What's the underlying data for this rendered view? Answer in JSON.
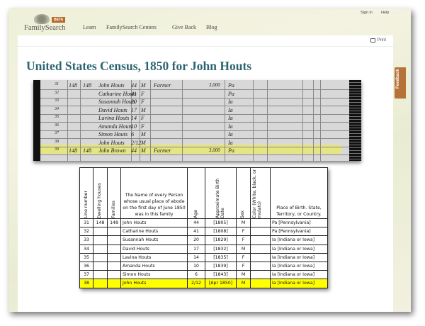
{
  "header": {
    "logo": "FamilySearch",
    "badge": "BETA",
    "nav": [
      "Learn",
      "FamilySearch Centers",
      "Give Back",
      "Blog"
    ],
    "sign_in": "Sign in",
    "help": "Help"
  },
  "toolbar": {
    "print": "Print"
  },
  "feedback": "Feedback",
  "page_title": "United States Census, 1850 for John Houts",
  "census_image": {
    "rows": [
      {
        "line": "31",
        "dwelling": "148",
        "family": "148",
        "name": "John Houts",
        "age": "44",
        "sex": "M",
        "occupation": "Farmer",
        "value": "3,000",
        "birth": "Pa"
      },
      {
        "line": "32",
        "name": "Catharine Houts",
        "age": "41",
        "sex": "F",
        "birth": "Pa"
      },
      {
        "line": "33",
        "name": "Susannah Houts",
        "age": "20",
        "sex": "F",
        "birth": "Ia"
      },
      {
        "line": "34",
        "name": "David Houts",
        "age": "17",
        "sex": "M",
        "birth": "Ia"
      },
      {
        "line": "35",
        "name": "Lavina Houts",
        "age": "14",
        "sex": "F",
        "birth": "Ia"
      },
      {
        "line": "36",
        "name": "Amanda Houts",
        "age": "10",
        "sex": "F",
        "birth": "Ia"
      },
      {
        "line": "37",
        "name": "Simon Houts",
        "age": "6",
        "sex": "M",
        "birth": "Ia"
      },
      {
        "line": "38",
        "name": "John Houts",
        "age": "2/12",
        "sex": "M",
        "birth": "Ia"
      },
      {
        "line": "39",
        "dwelling": "148",
        "family": "148",
        "name": "John Brown",
        "age": "44",
        "sex": "M",
        "occupation": "Farmer",
        "value": "3,000",
        "birth": "Pa"
      }
    ]
  },
  "table": {
    "headers": [
      "Line number",
      "Dwelling houses",
      "Families",
      "The Name of every Person whose usual place of abode on the first day of June 1850 was in this family",
      "Age",
      "Approximate Birth Date",
      "Sex",
      "Color (White, black, or mulato)",
      "Place of Birth. State, Territory, or Country."
    ],
    "rows": [
      [
        "31",
        "148",
        "148",
        "John Houts",
        "44",
        "[1805]",
        "M",
        "",
        "Pa [Pennsylvania]"
      ],
      [
        "32",
        "",
        "",
        "Catharine Houts",
        "41",
        "[1808]",
        "F",
        "",
        "Pa [Pennsylvania]"
      ],
      [
        "33",
        "",
        "",
        "Susannah Houts",
        "20",
        "[1829]",
        "F",
        "",
        "Ia [Indiana or Iowa]"
      ],
      [
        "34",
        "",
        "",
        "David Houts",
        "17",
        "[1832]",
        "M",
        "",
        "Ia [Indiana or Iowa]"
      ],
      [
        "35",
        "",
        "",
        "Lavina Houts",
        "14",
        "[1835]",
        "F",
        "",
        "Ia [Indiana or Iowa]"
      ],
      [
        "36",
        "",
        "",
        "Amanda Houts",
        "10",
        "[1839]",
        "F",
        "",
        "Ia [Indiana or Iowa]"
      ],
      [
        "37",
        "",
        "",
        "Simon Houts",
        "6",
        "[1843]",
        "M",
        "",
        "Ia [Indiana or Iowa]"
      ],
      [
        "38",
        "",
        "",
        "John Houts",
        "2/12",
        "[Apr 1850]",
        "M",
        "",
        "Ia [Indiana or Iowa]"
      ]
    ],
    "highlight_row": 7,
    "highlight_color": "#ffff00"
  }
}
